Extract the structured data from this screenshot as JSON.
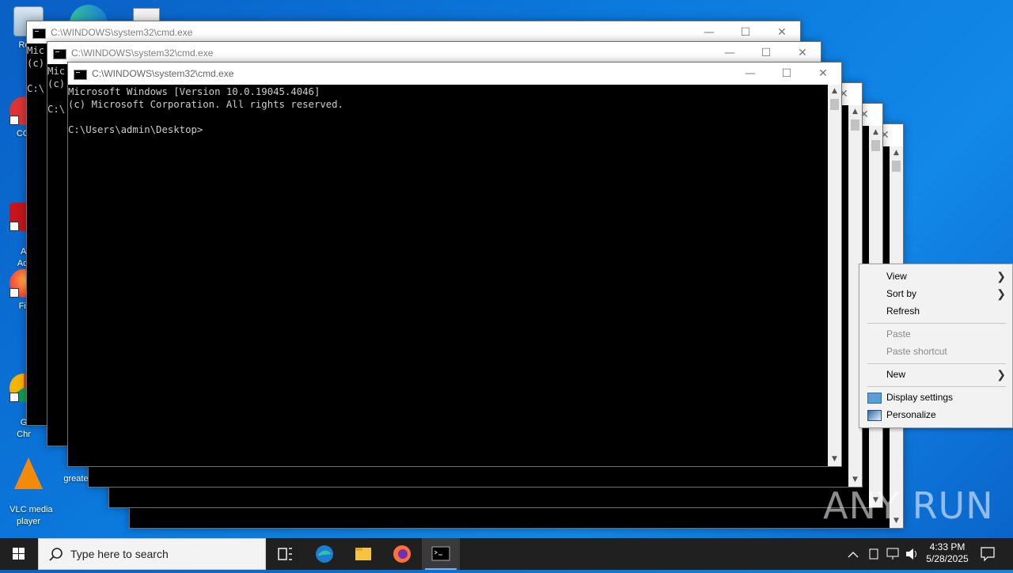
{
  "desktop": {
    "icons": [
      {
        "name": "recycle-bin",
        "label": "Recy"
      },
      {
        "name": "ccleaner",
        "label": "CCl"
      },
      {
        "name": "adobe-acrobat",
        "label": "Ad\nAcr"
      },
      {
        "name": "firefox",
        "label": "Fir"
      },
      {
        "name": "google-chrome",
        "label": "Go\nChr"
      },
      {
        "name": "vlc",
        "label": "VLC media\nplayer"
      },
      {
        "name": "greate",
        "label": "greate"
      }
    ]
  },
  "windows": [
    {
      "title": "C:\\WINDOWS\\system32\\cmd.exe",
      "lines": [
        "Mic",
        "(c)",
        "",
        "C:\\"
      ]
    },
    {
      "title": "C:\\WINDOWS\\system32\\cmd.exe",
      "lines": [
        "Mic",
        "(c)",
        "",
        "C:\\"
      ]
    },
    {
      "title": "C:\\WINDOWS\\system32\\cmd.exe",
      "lines": [
        "Microsoft Windows [Version 10.0.19045.4046]",
        "(c) Microsoft Corporation. All rights reserved.",
        "",
        "C:\\Users\\admin\\Desktop>"
      ]
    }
  ],
  "window_buttons": {
    "minimize": "—",
    "maximize": "☐",
    "close": "✕"
  },
  "context_menu": {
    "view": "View",
    "sort_by": "Sort by",
    "refresh": "Refresh",
    "paste": "Paste",
    "paste_shortcut": "Paste shortcut",
    "new": "New",
    "display_settings": "Display settings",
    "personalize": "Personalize"
  },
  "taskbar": {
    "search_placeholder": "Type here to search",
    "time": "4:33 PM",
    "date": "5/28/2025"
  },
  "watermark": "ANY RUN"
}
